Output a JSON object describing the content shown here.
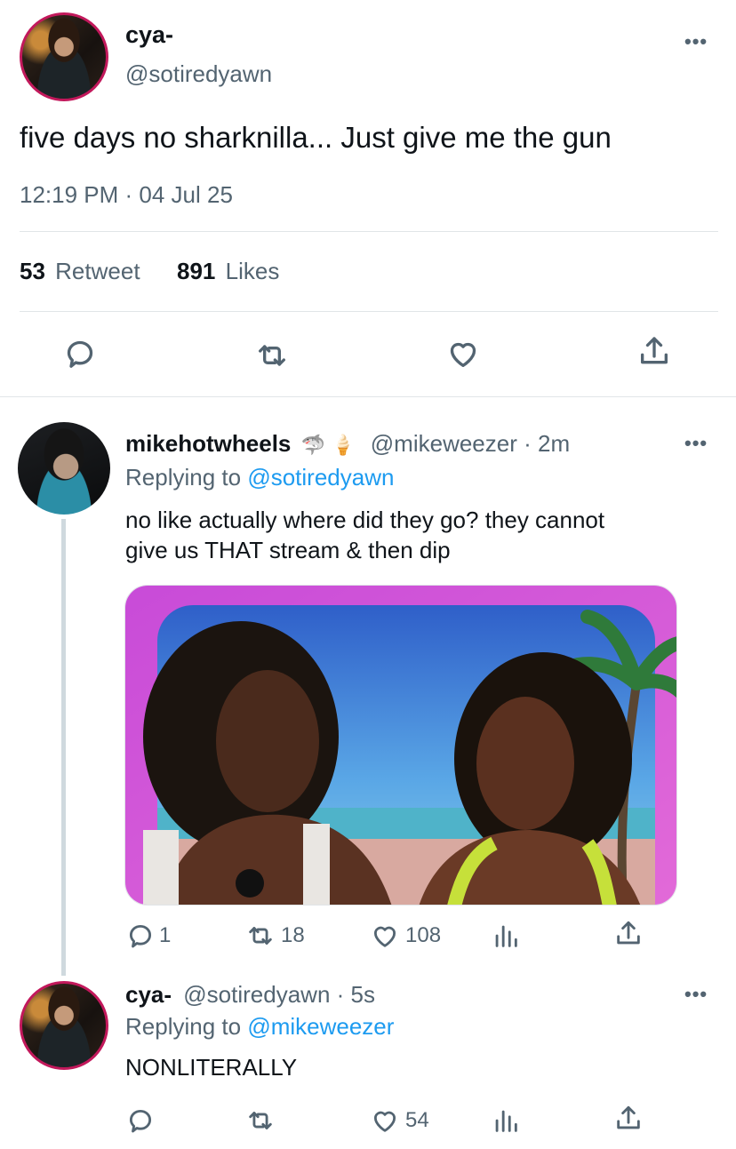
{
  "main_tweet": {
    "display_name": "cya-",
    "handle": "@sotiredyawn",
    "text": "five days no sharknilla... Just give me the gun",
    "timestamp": "12:19 PM · 04 Jul 25",
    "retweet_count": "53",
    "retweet_label": "Retweet",
    "like_count": "891",
    "like_label": "Likes"
  },
  "reply_1": {
    "display_name": "mikehotwheels",
    "name_emojis": "🦈 🍦",
    "handle": "@mikeweezer",
    "time": "· 2m",
    "replying_to_label": "Replying to",
    "replying_to": "@sotiredyawn",
    "text_line1": "no like actually where did they go? they cannot",
    "text_line2": "give us THAT stream & then dip",
    "reply_count": "1",
    "retweet_count": "18",
    "like_count": "108"
  },
  "reply_2": {
    "display_name": "cya-",
    "handle": "@sotiredyawn",
    "time": "· 5s",
    "replying_to_label": "Replying to",
    "replying_to": "@mikeweezer",
    "text": "NONLITERALLY",
    "like_count": "54"
  },
  "more_label": "•••",
  "colors": {
    "text": "#0f1419",
    "secondary": "#536471",
    "link": "#1d9bf0",
    "avatar_ring": "#c2185b"
  }
}
